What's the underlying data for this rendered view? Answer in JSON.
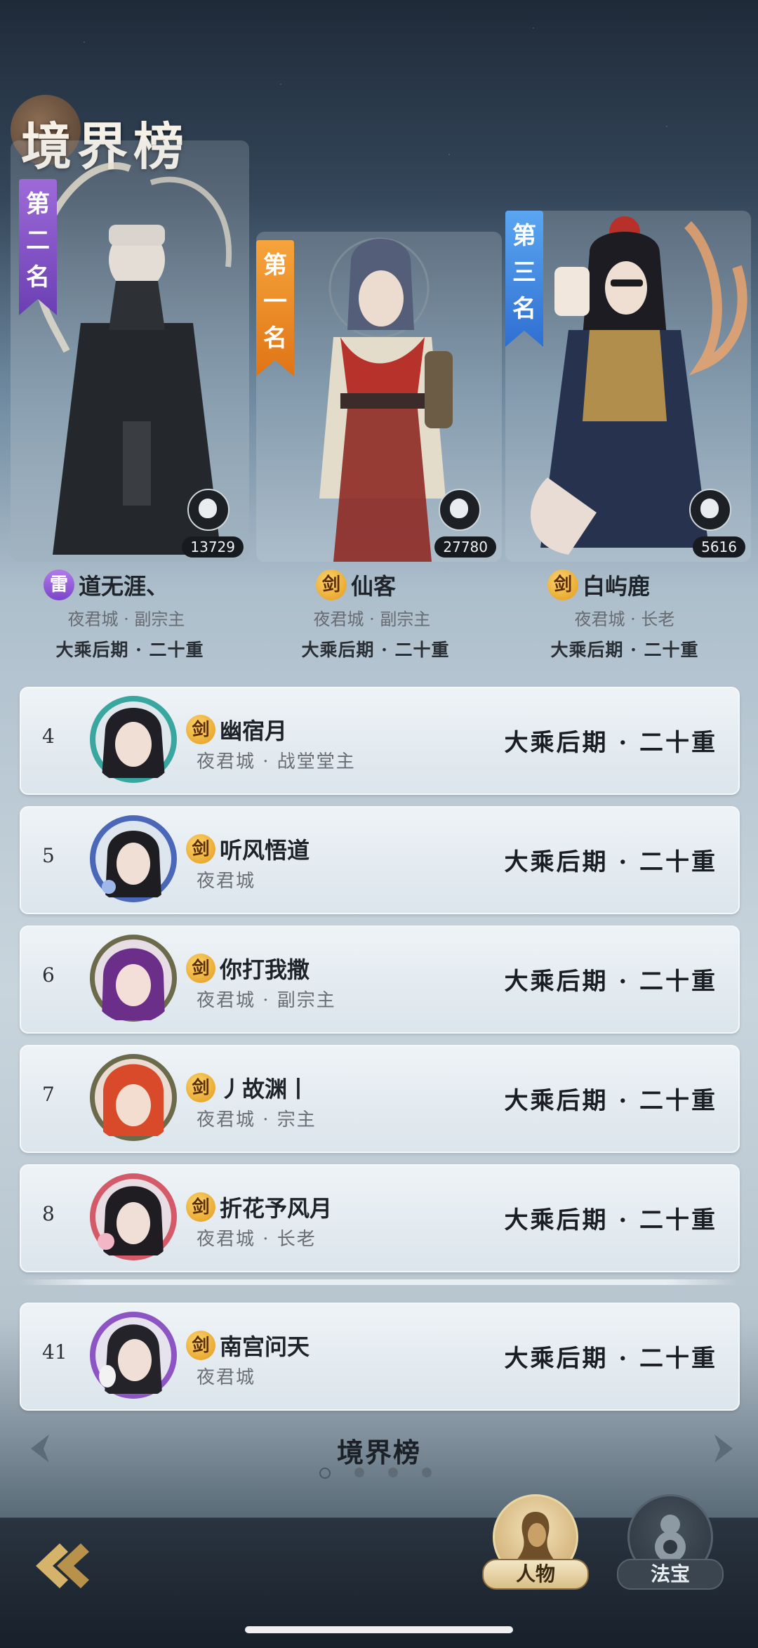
{
  "board_title": "境界榜",
  "podium": [
    {
      "ribbon": [
        "第",
        "二",
        "名"
      ],
      "name": "道无涯、",
      "sect": "雷",
      "sub": "夜君城 · 副宗主",
      "realm": "大乘后期 · 二十重",
      "power": "13729"
    },
    {
      "ribbon": [
        "第",
        "一",
        "名"
      ],
      "name": "仙客",
      "sect": "剑",
      "sub": "夜君城 · 副宗主",
      "realm": "大乘后期 · 二十重",
      "power": "27780"
    },
    {
      "ribbon": [
        "第",
        "三",
        "名"
      ],
      "name": "白屿鹿",
      "sect": "剑",
      "sub": "夜君城 · 长老",
      "realm": "大乘后期 · 二十重",
      "power": "5616"
    }
  ],
  "rows": [
    {
      "rank": "4",
      "sect": "剑",
      "name": "幽宿月",
      "sub": "夜君城 · 战堂堂主",
      "realm": "大乘后期 · 二十重"
    },
    {
      "rank": "5",
      "sect": "剑",
      "name": "听风悟道",
      "sub": "夜君城",
      "realm": "大乘后期 · 二十重"
    },
    {
      "rank": "6",
      "sect": "剑",
      "name": "你打我撒",
      "sub": "夜君城 · 副宗主",
      "realm": "大乘后期 · 二十重"
    },
    {
      "rank": "7",
      "sect": "剑",
      "name": "丿故渊丨",
      "sub": "夜君城 · 宗主",
      "realm": "大乘后期 · 二十重"
    },
    {
      "rank": "8",
      "sect": "剑",
      "name": "折花予风月",
      "sub": "夜君城 · 长老",
      "realm": "大乘后期 · 二十重"
    }
  ],
  "my_row": {
    "rank": "41",
    "sect": "剑",
    "name": "南宫问天",
    "sub": "夜君城",
    "realm": "大乘后期 · 二十重"
  },
  "page_title": "境界榜",
  "page_indicator": {
    "count": 4,
    "active": 1
  },
  "tabs": [
    {
      "label": "人物",
      "icon": "character-icon",
      "active": true
    },
    {
      "label": "法宝",
      "icon": "treasure-gourd-icon",
      "active": false
    }
  ],
  "colors": {
    "gold": "#e39a1d",
    "purple": "#7b45c9",
    "orange": "#e07416",
    "blue": "#2f6fd1"
  }
}
